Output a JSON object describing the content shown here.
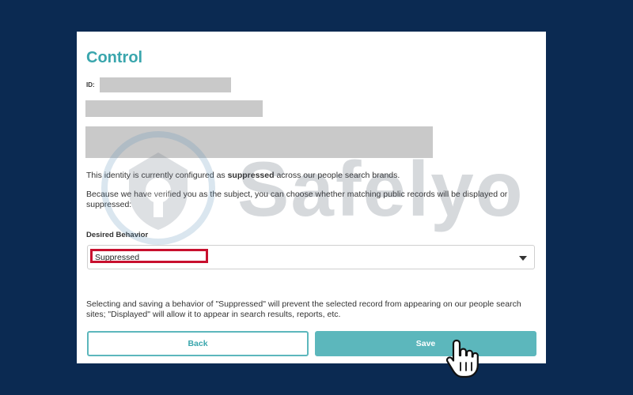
{
  "card": {
    "title": "Control",
    "id_label": "ID:"
  },
  "text": {
    "status_prefix": "This identity is currently configured as ",
    "status_value": "suppressed",
    "status_suffix": " across our people search brands.",
    "verified_note": "Because we have verified you as the subject, you can choose whether matching public records will be displayed or suppressed:",
    "footer_note": "Selecting and saving a behavior of \"Suppressed\" will prevent the selected record from appearing on our people search sites; \"Displayed\" will allow it to appear in search results, reports, etc."
  },
  "form": {
    "label": "Desired Behavior",
    "selected": "Suppressed"
  },
  "buttons": {
    "back": "Back",
    "save": "Save"
  },
  "watermark": {
    "text": "Safelyo"
  },
  "colors": {
    "background": "#0b2a52",
    "accent": "#3aa6ad",
    "button_fill": "#5cb7bc",
    "highlight": "#c8102e",
    "redaction": "#c9c9c9"
  },
  "icons": {
    "dropdown": "chevron-down-icon",
    "pointer": "hand-pointer-icon",
    "watermark_logo": "shield-logo-icon"
  }
}
